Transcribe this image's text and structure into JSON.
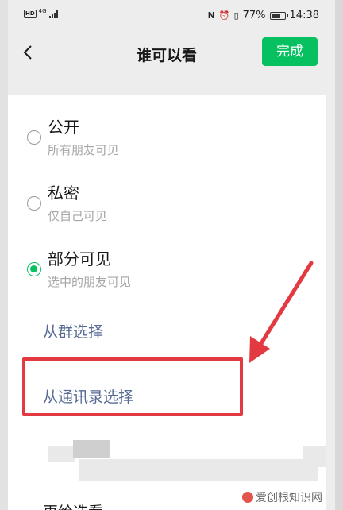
{
  "status_bar": {
    "hd": "HD",
    "network": "4G",
    "battery_text": "77%",
    "battery_level": 0.77,
    "time": "14:38"
  },
  "nav": {
    "title": "谁可以看",
    "done_label": "完成"
  },
  "options": [
    {
      "label": "公开",
      "sub": "所有朋友可见",
      "checked": false
    },
    {
      "label": "私密",
      "sub": "仅自己可见",
      "checked": false
    },
    {
      "label": "部分可见",
      "sub": "选中的朋友可见",
      "checked": true
    }
  ],
  "links": {
    "from_group": "从群选择",
    "from_contacts": "从通讯录选择"
  },
  "bottom_partial": "再给选看",
  "watermark": "爱创根知识网",
  "colors": {
    "accent": "#07c160",
    "link": "#576b95",
    "annotation": "#e33a41"
  }
}
